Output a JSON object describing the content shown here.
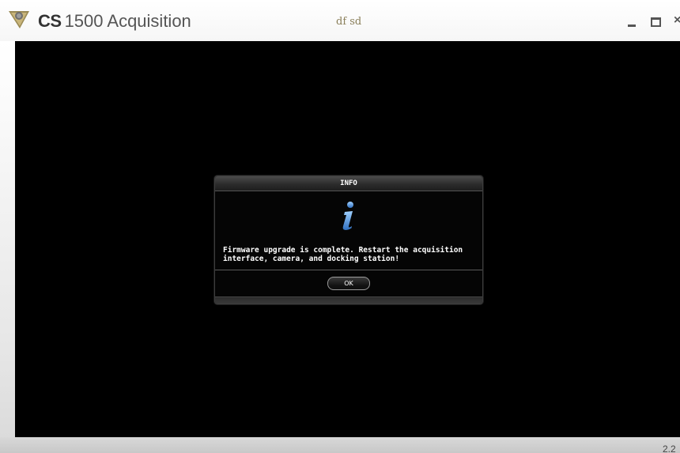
{
  "window": {
    "brand_cs": "CS",
    "brand_name": "1500 Acquisition",
    "patient_name": "df sd",
    "controls": {
      "minimize": "minimize",
      "maximize": "maximize",
      "close": "×"
    }
  },
  "status": {
    "version": "2.2"
  },
  "dialog": {
    "title": "INFO",
    "icon": "info-icon",
    "message": "Firmware upgrade is complete. Restart the acquisition interface, camera, and docking station!",
    "ok_label": "OK"
  },
  "colors": {
    "viewport": "#000000",
    "info_icon_blue": "#4a90d9",
    "patient_text": "#8a7f5a",
    "logo_gold": "#b9a46a"
  }
}
